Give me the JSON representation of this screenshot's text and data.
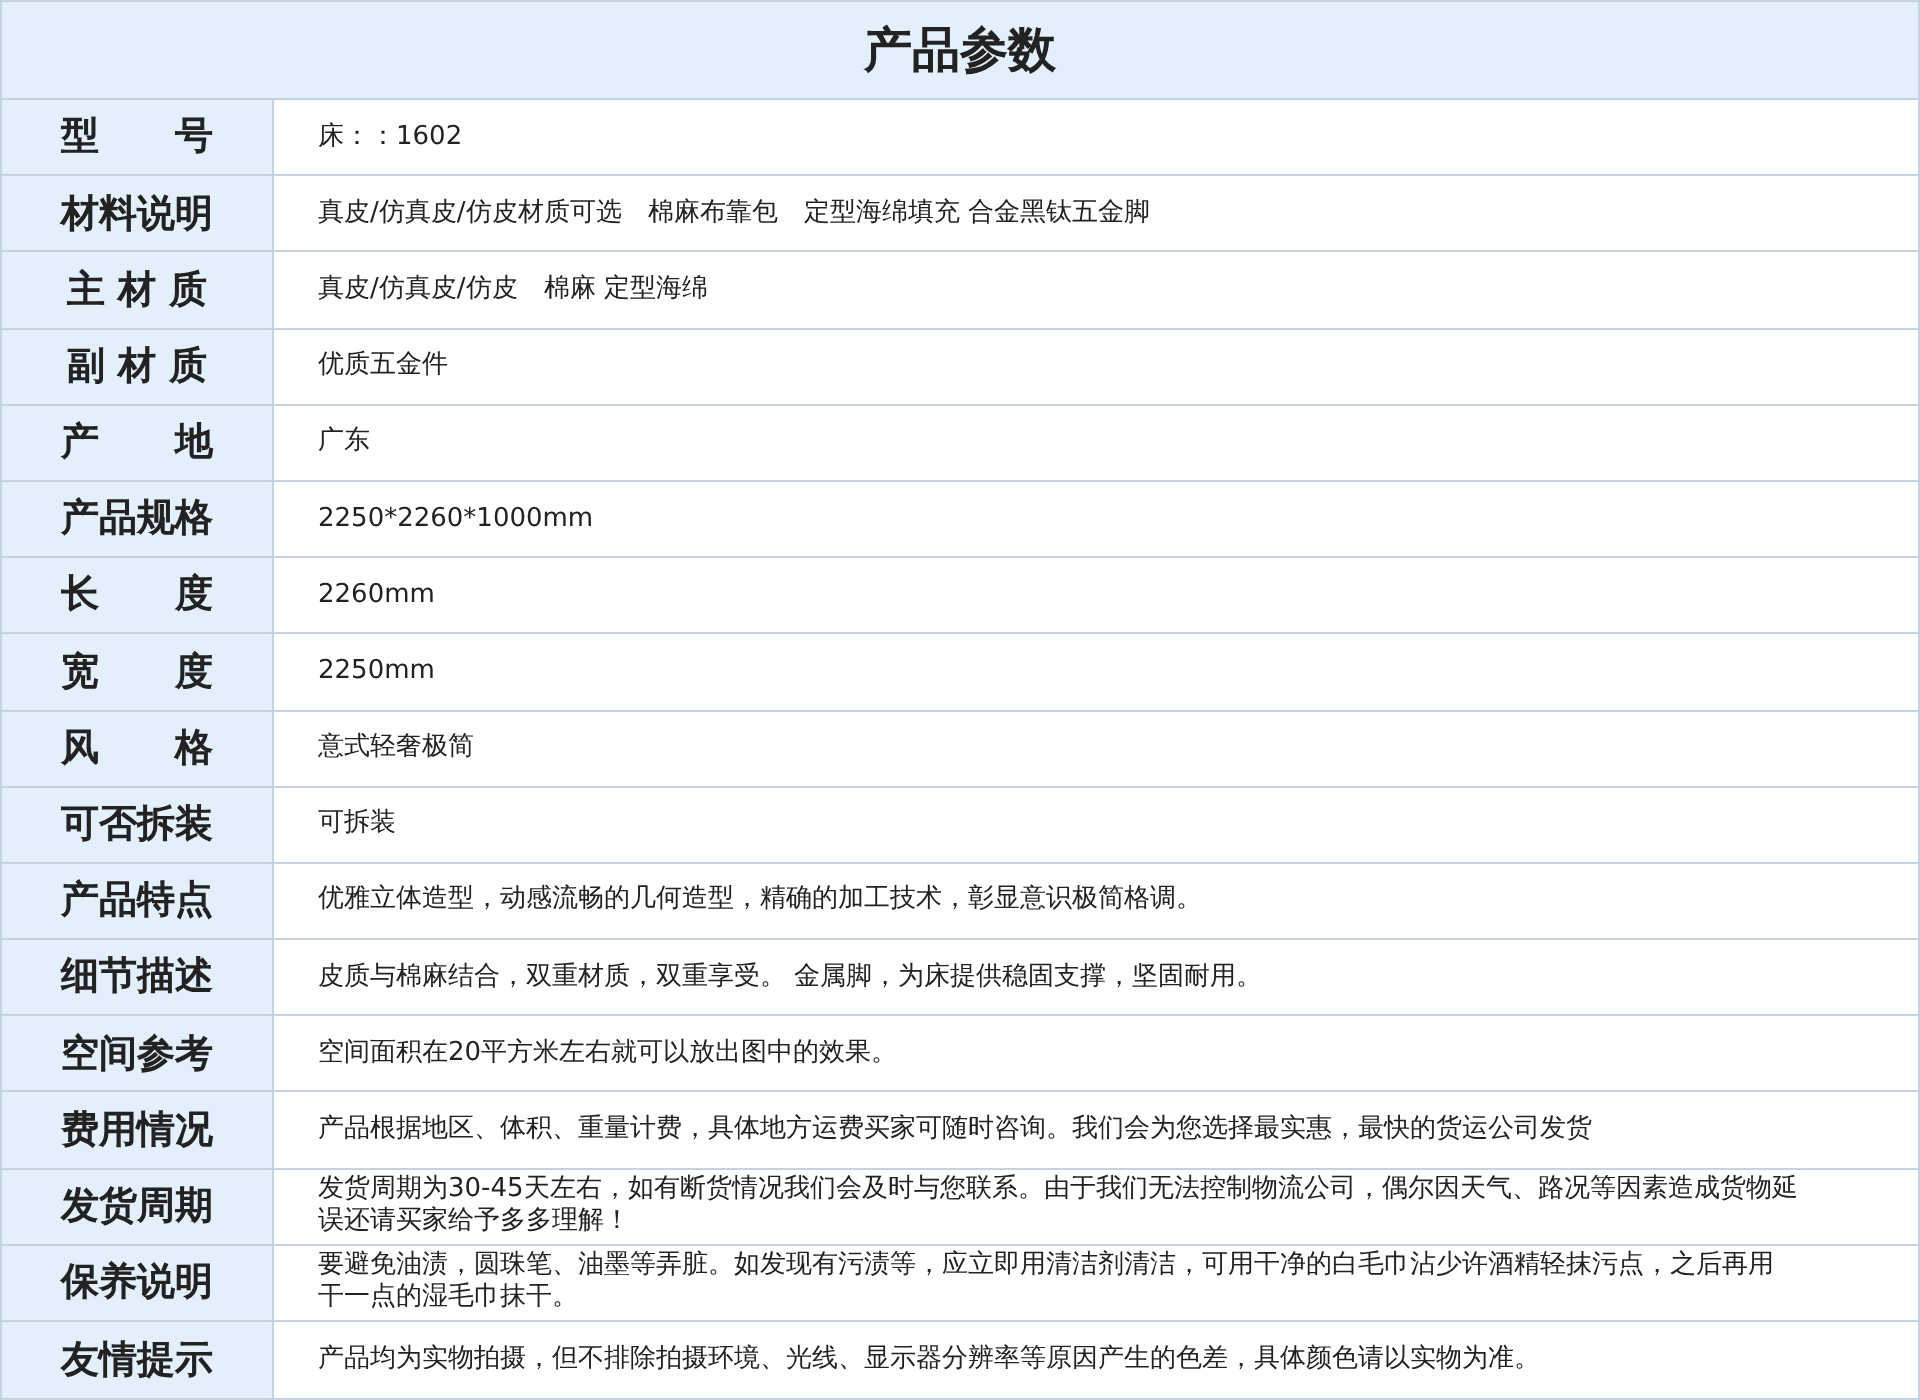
{
  "title": "产品参数",
  "rows": [
    {
      "label": "型　　号",
      "value": "床：：1602"
    },
    {
      "label": "材料说明",
      "value": "真皮/仿真皮/仿皮材质可选　棉麻布靠包　定型海绵填充 合金黑钛五金脚"
    },
    {
      "label": "主 材 质",
      "value": "真皮/仿真皮/仿皮　棉麻 定型海绵"
    },
    {
      "label": "副 材 质",
      "value": "优质五金件"
    },
    {
      "label": "产　　地",
      "value": "广东"
    },
    {
      "label": "产品规格",
      "value": "2250*2260*1000mm"
    },
    {
      "label": "长　　度",
      "value": "2260mm"
    },
    {
      "label": "宽　　度",
      "value": "2250mm"
    },
    {
      "label": "风　　格",
      "value": "意式轻奢极简"
    },
    {
      "label": "可否拆装",
      "value": "可拆装"
    },
    {
      "label": "产品特点",
      "value": "优雅立体造型，动感流畅的几何造型，精确的加工技术，彰显意识极简格调。"
    },
    {
      "label": "细节描述",
      "value": "皮质与棉麻结合，双重材质，双重享受。 金属脚，为床提供稳固支撑，坚固耐用。"
    },
    {
      "label": "空间参考",
      "value": "空间面积在20平方米左右就可以放出图中的效果。"
    },
    {
      "label": "费用情况",
      "value": "产品根据地区、体积、重量计费，具体地方运费买家可随时咨询。我们会为您选择最实惠，最快的货运公司发货"
    },
    {
      "label": "发货周期",
      "value": "发货周期为30-45天左右，如有断货情况我们会及时与您联系。由于我们无法控制物流公司，偶尔因天气、路况等因素造成货物延误还请买家给予多多理解！"
    },
    {
      "label": "保养说明",
      "value": "要避免油渍，圆珠笔、油墨等弄脏。如发现有污渍等，应立即用清洁剂清洁，可用干净的白毛巾沾少许酒精轻抹污点，之后再用干一点的湿毛巾抹干。"
    },
    {
      "label": "友情提示",
      "value": "产品均为实物拍摄，但不排除拍摄环境、光线、显示器分辨率等原因产生的色差，具体颜色请以实物为准。"
    }
  ]
}
